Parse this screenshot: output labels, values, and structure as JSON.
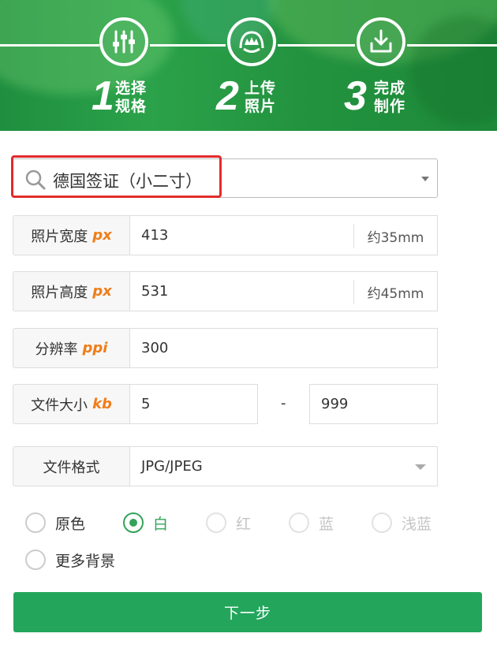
{
  "steps": [
    {
      "num": "1",
      "line1": "选择",
      "line2": "规格",
      "icon": "sliders-icon"
    },
    {
      "num": "2",
      "line1": "上传",
      "line2": "照片",
      "icon": "portrait-upload-icon"
    },
    {
      "num": "3",
      "line1": "完成",
      "line2": "制作",
      "icon": "download-icon"
    }
  ],
  "search": {
    "value": "德国签证（小二寸）",
    "icon": "search-icon"
  },
  "width_row": {
    "label": "照片宽度",
    "unit": "px",
    "value": "413",
    "mm": "约35mm"
  },
  "height_row": {
    "label": "照片高度",
    "unit": "px",
    "value": "531",
    "mm": "约45mm"
  },
  "dpi_row": {
    "label": "分辨率",
    "unit": "ppi",
    "value": "300"
  },
  "size_row": {
    "label": "文件大小",
    "unit": "kb",
    "min": "5",
    "separator": "-",
    "max": "999"
  },
  "format_row": {
    "label": "文件格式",
    "value": "JPG/JPEG"
  },
  "backgrounds": [
    {
      "label": "原色",
      "state": "normal"
    },
    {
      "label": "白",
      "state": "selected"
    },
    {
      "label": "红",
      "state": "disabled"
    },
    {
      "label": "蓝",
      "state": "disabled"
    },
    {
      "label": "浅蓝",
      "state": "disabled"
    },
    {
      "label": "更多背景",
      "state": "normal"
    }
  ],
  "next_button": {
    "label": "下一步"
  },
  "colors": {
    "brand_green": "#23a65c",
    "unit_orange": "#f07d1a",
    "highlight_red": "#e22b2b"
  }
}
